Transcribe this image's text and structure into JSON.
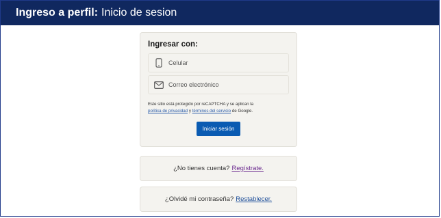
{
  "header": {
    "title_bold": "Ingreso a perfil:",
    "title_light": "Inicio de sesion"
  },
  "login": {
    "title": "Ingresar con:",
    "options": [
      {
        "label": "Celular",
        "icon": "phone-icon"
      },
      {
        "label": "Correo electrónico",
        "icon": "envelope-icon"
      }
    ],
    "legal_text_1": "Este sitio está protegido por reCAPTCHA y se aplican la",
    "privacy_link": "política de privacidad",
    "and_text": "y",
    "terms_link": "términos del servicio",
    "legal_text_2": "de Google.",
    "submit_label": "Iniciar sesión"
  },
  "register": {
    "prompt": "¿No tienes cuenta?",
    "link": "Regístrate."
  },
  "reset": {
    "prompt": "¿Olvidé mi contraseña?",
    "link": "Restablecer."
  },
  "colors": {
    "header_bg": "#10285f",
    "button_bg": "#0a5bb2",
    "card_bg": "#f4f3ef"
  }
}
